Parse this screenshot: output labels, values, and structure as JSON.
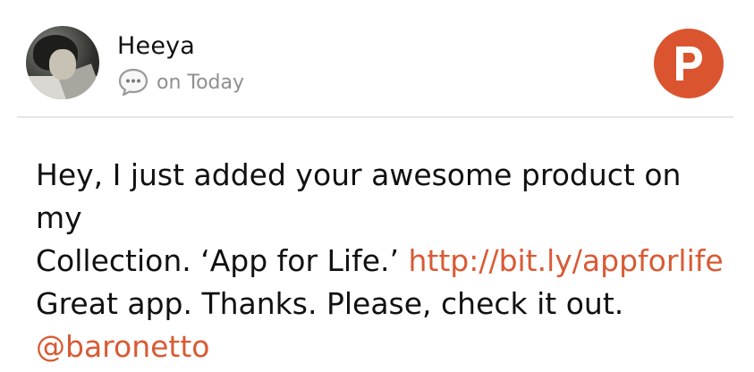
{
  "post": {
    "author": "Heeya",
    "meta_text": "on Today",
    "avatar_icon": "user-avatar",
    "comment_icon": "speech-bubble-icon",
    "badge_icon": "product-hunt-p-icon",
    "badge_letter": "P",
    "badge_color": "#da552f",
    "link_color": "#d95a34",
    "text_line1": "Hey, I just added your awesome product on my",
    "text_line2": "Collection. ‘App for Life.’ ",
    "link_url": "http://bit.ly/appforlife",
    "text_line3": "Great app. Thanks. Please, check it out.",
    "mention": "@baronetto"
  }
}
